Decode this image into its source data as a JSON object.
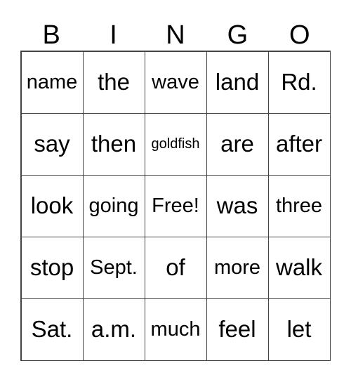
{
  "header": [
    "B",
    "I",
    "N",
    "G",
    "O"
  ],
  "cells": [
    [
      "name",
      "the",
      "wave",
      "land",
      "Rd."
    ],
    [
      "say",
      "then",
      "goldfish",
      "are",
      "after"
    ],
    [
      "look",
      "going",
      "Free!",
      "was",
      "three"
    ],
    [
      "stop",
      "Sept.",
      "of",
      "more",
      "walk"
    ],
    [
      "Sat.",
      "a.m.",
      "much",
      "feel",
      "let"
    ]
  ]
}
